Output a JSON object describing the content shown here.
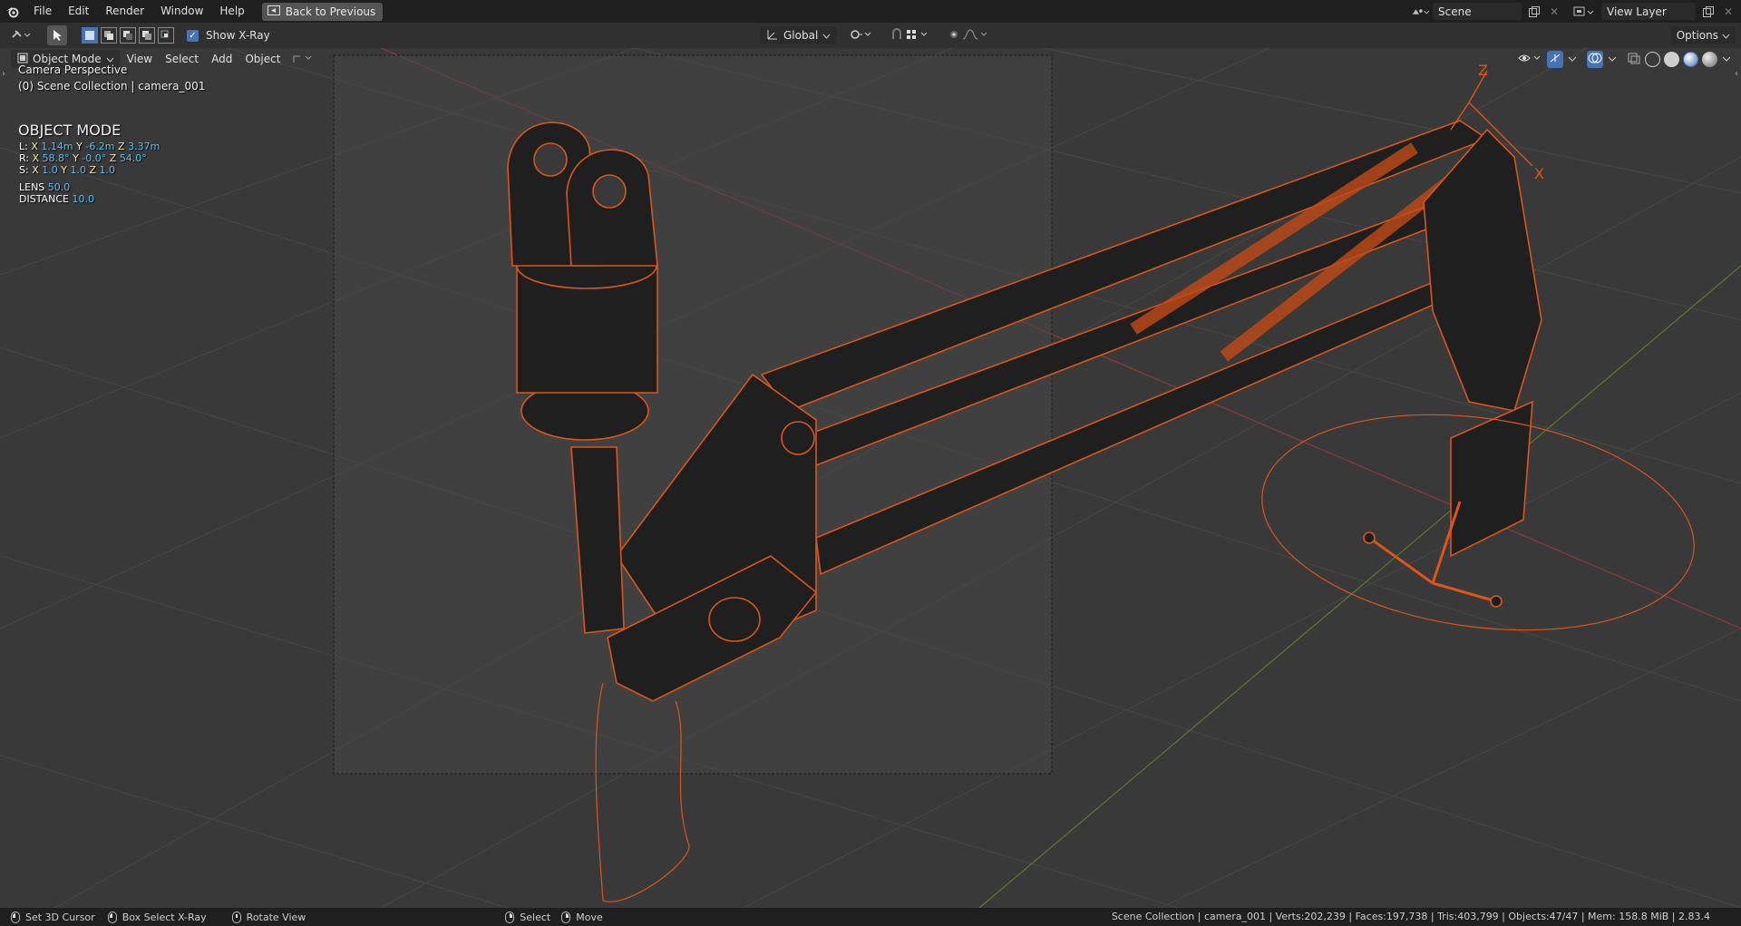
{
  "menu": {
    "items": [
      "File",
      "Edit",
      "Render",
      "Window",
      "Help"
    ],
    "back_button": "Back to Previous"
  },
  "topbar_right": {
    "scene_name": "Scene",
    "view_layer_name": "View Layer"
  },
  "toolbar": {
    "show_xray_label": "Show X-Ray",
    "show_xray_checked": true,
    "transform_orientation": "Global",
    "options_label": "Options"
  },
  "viewport_header": {
    "mode": "Object Mode",
    "menus": [
      "View",
      "Select",
      "Add",
      "Object"
    ]
  },
  "viewport_info": {
    "view_name": "Camera Perspective",
    "collection_line": "(0) Scene Collection | camera_001",
    "mode_title": "OBJECT MODE",
    "location": {
      "prefix": "L:",
      "x": "1.14m",
      "y": "-6.2m",
      "z": "3.37m"
    },
    "rotation": {
      "prefix": "R:",
      "x": "58.8°",
      "y": "-0.0°",
      "z": "54.0°"
    },
    "scale": {
      "prefix": "S:",
      "x": "1.0",
      "y": "1.0",
      "z": "1.0"
    },
    "lens_label": "LENS",
    "lens_value": "50.0",
    "distance_label": "DISTANCE",
    "distance_value": "10.0"
  },
  "gizmo_labels": {
    "z": "Z",
    "x": "X"
  },
  "statusbar": {
    "set_cursor": "Set 3D Cursor",
    "box_select": "Box Select X-Ray",
    "rotate_view": "Rotate View",
    "select": "Select",
    "move": "Move",
    "stats": "Scene Collection | camera_001 | Verts:202,239 | Faces:197,738 | Tris:403,799 | Objects:47/47 | Mem: 158.8 MiB | 2.83.4"
  },
  "colors": {
    "selection_orange": "#d9561b",
    "x_axis": "#8c3a3a",
    "y_axis": "#5c7a2a",
    "accent_blue": "#4772b3"
  }
}
